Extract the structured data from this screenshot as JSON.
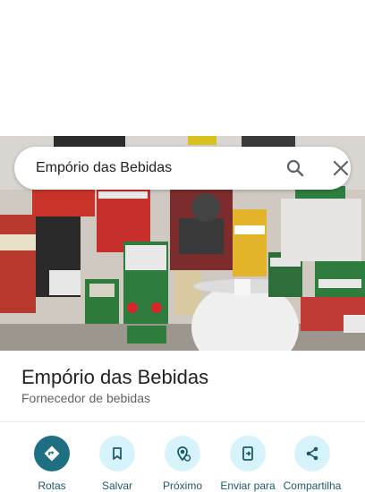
{
  "search": {
    "query": "Empório das Bebidas",
    "search_icon": "search-icon",
    "close_icon": "close-icon"
  },
  "place": {
    "name": "Empório das Bebidas",
    "category": "Fornecedor de bebidas"
  },
  "photo": {
    "alt": "store-photo"
  },
  "actions": [
    {
      "label": "Rotas",
      "icon": "directions-icon"
    },
    {
      "label": "Salvar",
      "icon": "bookmark-icon"
    },
    {
      "label": "Próximo",
      "icon": "nearby-icon"
    },
    {
      "label": "Enviar para",
      "icon": "send-to-phone-icon"
    },
    {
      "label": "Compartilha",
      "icon": "share-icon"
    }
  ],
  "colors": {
    "primary_action": "#1f6f82",
    "secondary_action_bg": "#d6f3fb",
    "action_label": "#1f5a6a"
  }
}
